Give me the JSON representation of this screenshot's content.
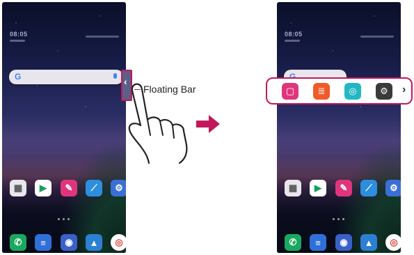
{
  "left_phone": {
    "clock": "08:05",
    "apps_row": [
      {
        "icon": "folder-icon",
        "color": "#e8e6ec"
      },
      {
        "icon": "play-store-icon",
        "color": "#ffffff"
      },
      {
        "icon": "pen-icon",
        "color": "#e0357d"
      },
      {
        "icon": "compass-icon",
        "color": "#2d8ee0"
      },
      {
        "icon": "settings-icon",
        "color": "#3b6fd6"
      }
    ],
    "dock": [
      {
        "icon": "phone-icon",
        "color": "#1aa860"
      },
      {
        "icon": "messages-icon",
        "color": "#2f6fd8"
      },
      {
        "icon": "camera-icon",
        "color": "#3a61c7"
      },
      {
        "icon": "gallery-icon",
        "color": "#2c7fd2"
      },
      {
        "icon": "chrome-icon",
        "color": "#ffffff"
      }
    ]
  },
  "right_phone": {
    "clock": "08:05"
  },
  "callout": {
    "label": "Floating Bar"
  },
  "floating_bar": {
    "items": [
      {
        "icon": "note-icon",
        "color": "#e0357d"
      },
      {
        "icon": "list-icon",
        "color": "#f05a28"
      },
      {
        "icon": "qlens-icon",
        "color": "#23b7c4"
      },
      {
        "icon": "capture-icon",
        "color": "#3a3a3a"
      }
    ],
    "more": "›"
  },
  "accent_color": "#c2185b"
}
